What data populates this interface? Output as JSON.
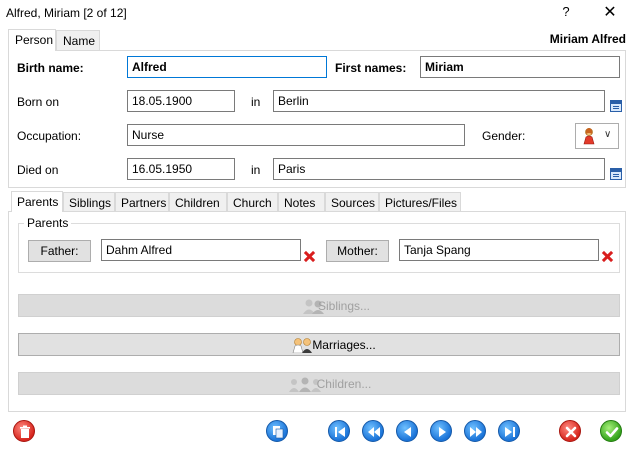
{
  "window": {
    "title": "Alfred, Miriam [2 of 12]",
    "help": "?",
    "close": "✕"
  },
  "top_tabs": [
    "Person",
    "Name"
  ],
  "header_name": "Miriam Alfred",
  "form": {
    "birth_name_label": "Birth name:",
    "birth_name_value": "Alfred",
    "first_names_label": "First names:",
    "first_names_value": "Miriam",
    "born_on_label": "Born on",
    "born_on_value": "18.05.1900",
    "born_in_label": "in",
    "born_in_value": "Berlin",
    "occupation_label": "Occupation:",
    "occupation_value": "Nurse",
    "gender_label": "Gender:",
    "gender_icon": "female-icon",
    "died_on_label": "Died on",
    "died_on_value": "16.05.1950",
    "died_in_label": "in",
    "died_in_value": "Paris"
  },
  "lower_tabs": [
    "Parents",
    "Siblings",
    "Partners",
    "Children",
    "Church",
    "Notes",
    "Sources",
    "Pictures/Files"
  ],
  "parents": {
    "group_title": "Parents",
    "father_button": "Father:",
    "father_value": "Dahm Alfred",
    "mother_button": "Mother:",
    "mother_value": "Tanja Spang"
  },
  "actions": {
    "siblings": "Siblings...",
    "marriages": "Marriages...",
    "children": "Children..."
  },
  "colors": {
    "accent_blue": "#1a73d8",
    "delete_red": "#d7261e",
    "ok_green": "#33a31a"
  }
}
